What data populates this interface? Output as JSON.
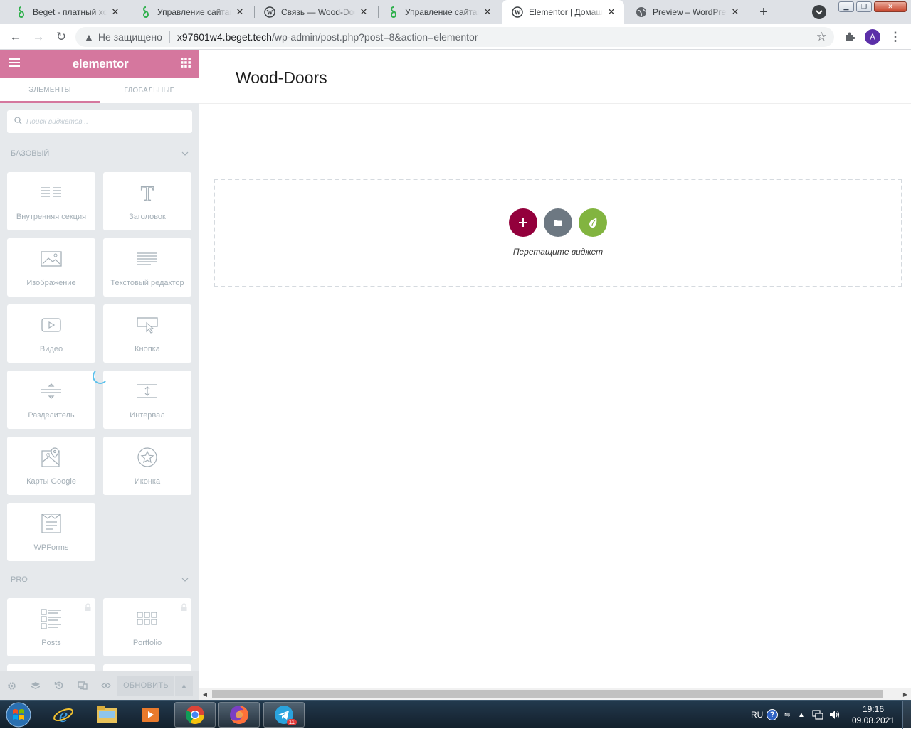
{
  "browser": {
    "tabs": [
      {
        "label": "Beget - платный хостинг",
        "icon": "beget-icon",
        "active": false
      },
      {
        "label": "Управление сайтами",
        "icon": "beget-icon",
        "active": false
      },
      {
        "label": "Связь — Wood-Doors",
        "icon": "wordpress-icon",
        "active": false
      },
      {
        "label": "Управление сайтами",
        "icon": "beget-icon",
        "active": false
      },
      {
        "label": "Elementor | Домашняя",
        "icon": "wordpress-icon",
        "active": true
      },
      {
        "label": "Preview – WordPress",
        "icon": "globe-icon",
        "active": false
      }
    ],
    "address": {
      "security_label": "Не защищено",
      "host": "x97601w4.beget.tech",
      "path": "/wp-admin/post.php?post=8&action=elementor"
    },
    "profile_initial": "A"
  },
  "panel": {
    "logo": "elementor",
    "tabs": {
      "elements": "ЭЛЕМЕНТЫ",
      "global": "ГЛОБАЛЬНЫЕ"
    },
    "search_placeholder": "Поиск виджетов...",
    "categories": {
      "basic": {
        "title": "БАЗОВЫЙ",
        "widgets": [
          {
            "label": "Внутренняя секция",
            "icon": "inner-section-icon"
          },
          {
            "label": "Заголовок",
            "icon": "heading-icon"
          },
          {
            "label": "Изображение",
            "icon": "image-icon"
          },
          {
            "label": "Текстовый редактор",
            "icon": "text-editor-icon"
          },
          {
            "label": "Видео",
            "icon": "video-icon"
          },
          {
            "label": "Кнопка",
            "icon": "button-icon"
          },
          {
            "label": "Разделитель",
            "icon": "divider-icon"
          },
          {
            "label": "Интервал",
            "icon": "spacer-icon"
          },
          {
            "label": "Карты Google",
            "icon": "google-maps-icon"
          },
          {
            "label": "Иконка",
            "icon": "star-icon"
          },
          {
            "label": "WPForms",
            "icon": "wpforms-icon"
          }
        ]
      },
      "pro": {
        "title": "PRO",
        "widgets": [
          {
            "label": "Posts",
            "icon": "posts-icon",
            "locked": true
          },
          {
            "label": "Portfolio",
            "icon": "portfolio-icon",
            "locked": true
          }
        ]
      }
    },
    "footer": {
      "update_label": "ОБНОВИТЬ"
    }
  },
  "preview": {
    "page_title": "Wood-Doors",
    "dropzone_text": "Перетащите виджет"
  },
  "colors": {
    "elementor_pink": "#d5779e",
    "add_button": "#93003c",
    "template_button": "#6d7882",
    "envato_button": "#82b440"
  },
  "taskbar": {
    "language": "RU",
    "time": "19:16",
    "date": "09.08.2021",
    "telegram_badge": "11"
  }
}
